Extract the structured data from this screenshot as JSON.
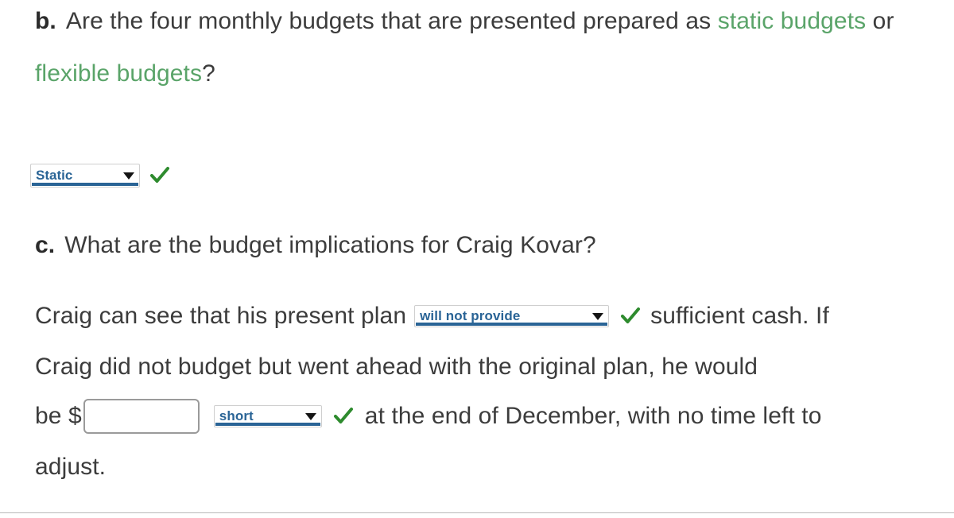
{
  "question_b": {
    "letter": "b.",
    "text_part_1": "Are the four monthly budgets that are presented prepared as ",
    "highlight_1": "static budgets",
    "text_part_2": " or ",
    "highlight_2": "flexible budgets",
    "text_part_3": "?"
  },
  "static_answer": {
    "dropdown_value": "Static",
    "dropdown_icon": "chevron-down-icon",
    "status_icon": "green-check-icon",
    "accent_color": "#2a6496",
    "check_color": "#2e8b2e"
  },
  "question_c": {
    "letter": "c.",
    "text": "What are the budget implications for Craig Kovar?"
  },
  "answer_c": {
    "line1_before": "Craig can see that his present plan",
    "dropdown_1_value": "will not provide",
    "dropdown_1_icon": "chevron-down-icon",
    "check_1_icon": "green-check-icon",
    "line1_after": "sufficient cash. If",
    "line2": "Craig did not budget but went ahead with the original plan, he would",
    "line3_before": "be $",
    "amount_value": "",
    "amount_placeholder": "",
    "dropdown_2_value": "short",
    "dropdown_2_icon": "chevron-down-icon",
    "check_2_icon": "green-check-icon",
    "line3_after": "at the end of December, with no time left to",
    "line4": "adjust."
  },
  "colors": {
    "green_highlight": "#5aa469",
    "body_text": "#3c3c3c",
    "dropdown_text": "#2a6496",
    "check_green": "#2e8b2e",
    "divider": "#b9b9b9"
  }
}
